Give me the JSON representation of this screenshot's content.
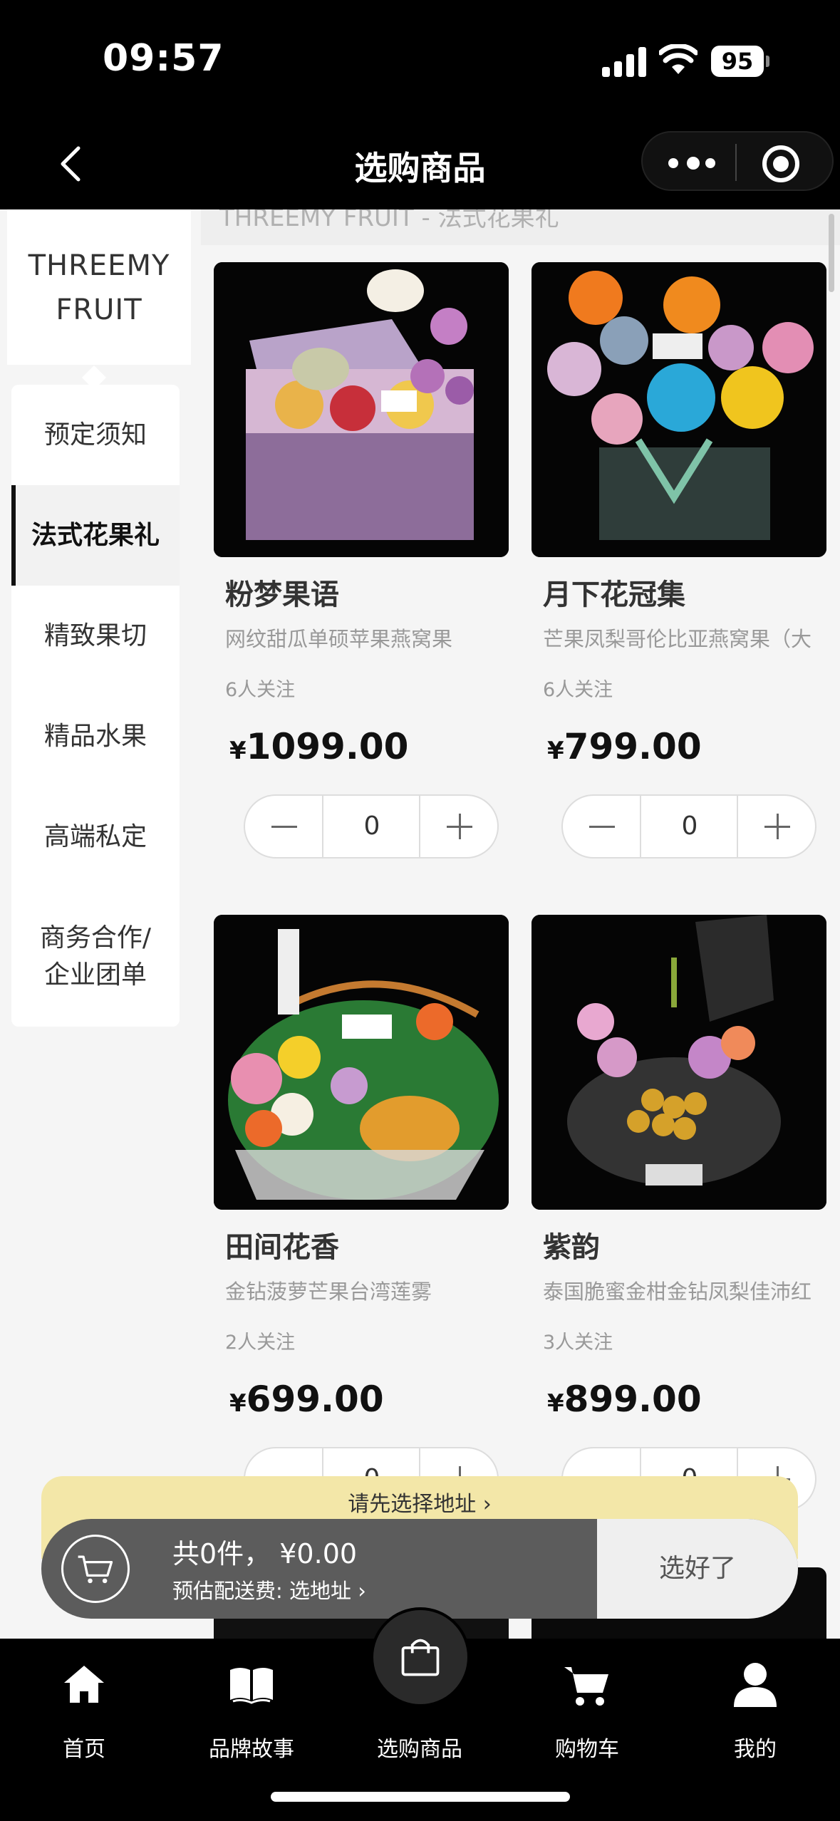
{
  "status_bar": {
    "time": "09:57",
    "battery": "95"
  },
  "navbar": {
    "title": "选购商品"
  },
  "sidebar": {
    "brand_line1": "THREEMY",
    "brand_line2": "FRUIT",
    "categories": [
      {
        "label": "预定须知"
      },
      {
        "label": "法式花果礼",
        "active": true
      },
      {
        "label": "精致果切"
      },
      {
        "label": "精品水果"
      },
      {
        "label": "高端私定"
      },
      {
        "label": "商务合作/企业团单"
      }
    ]
  },
  "section": {
    "title": "THREEMY FRUIT - 法式花果礼"
  },
  "products": [
    {
      "name": "粉梦果语",
      "desc": "网纹甜瓜单硕苹果燕窝果",
      "followers": "6人关注",
      "currency": "¥",
      "price": "1099.00",
      "qty": "0"
    },
    {
      "name": "月下花冠集",
      "desc": "芒果凤梨哥伦比亚燕窝果（大",
      "followers": "6人关注",
      "currency": "¥",
      "price": "799.00",
      "qty": "0"
    },
    {
      "name": "田间花香",
      "desc": "金钻菠萝芒果台湾莲雾",
      "followers": "2人关注",
      "currency": "¥",
      "price": "699.00",
      "qty": "0"
    },
    {
      "name": "紫韵",
      "desc": "泰国脆蜜金柑金钻凤梨佳沛红",
      "followers": "3人关注",
      "currency": "¥",
      "price": "899.00",
      "qty": "0"
    }
  ],
  "cart": {
    "address_prompt": "请先选择地址 ›",
    "total": "共0件， ¥0.00",
    "delivery_fee": "预估配送费: 选地址 ›",
    "checkout_label": "选好了"
  },
  "tabbar": {
    "items": [
      {
        "label": "首页",
        "icon": "home-icon"
      },
      {
        "label": "品牌故事",
        "icon": "book-icon"
      },
      {
        "label": "选购商品",
        "icon": "shopping-bag-icon"
      },
      {
        "label": "购物车",
        "icon": "cart-icon"
      },
      {
        "label": "我的",
        "icon": "user-icon"
      }
    ]
  },
  "colors": {
    "accent": "#000000",
    "address_banner": "#f3e7a8",
    "cart_bar": "#5c5c5c"
  }
}
